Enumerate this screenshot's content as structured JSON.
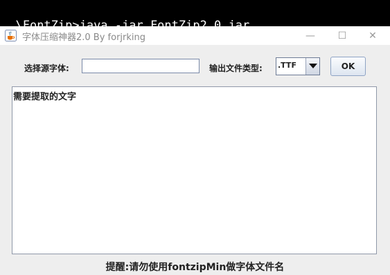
{
  "console": {
    "command": "\\FontZip>java -jar FontZip2.0.jar"
  },
  "window": {
    "title": "字体压缩神器2.0 By forjrking",
    "icon": "java-coffee-icon",
    "controls": {
      "minimize": "—",
      "maximize": "☐",
      "close": "✕"
    }
  },
  "form": {
    "source_font_label": "选择源字体:",
    "source_font_value": "",
    "output_type_label": "输出文件类型:",
    "output_type_selected": ".TTF",
    "ok_label": "OK",
    "text_area_value": "需要提取的文字"
  },
  "footer": {
    "hint": "提醒:请勿使用fontzipMin做字体文件名"
  }
}
